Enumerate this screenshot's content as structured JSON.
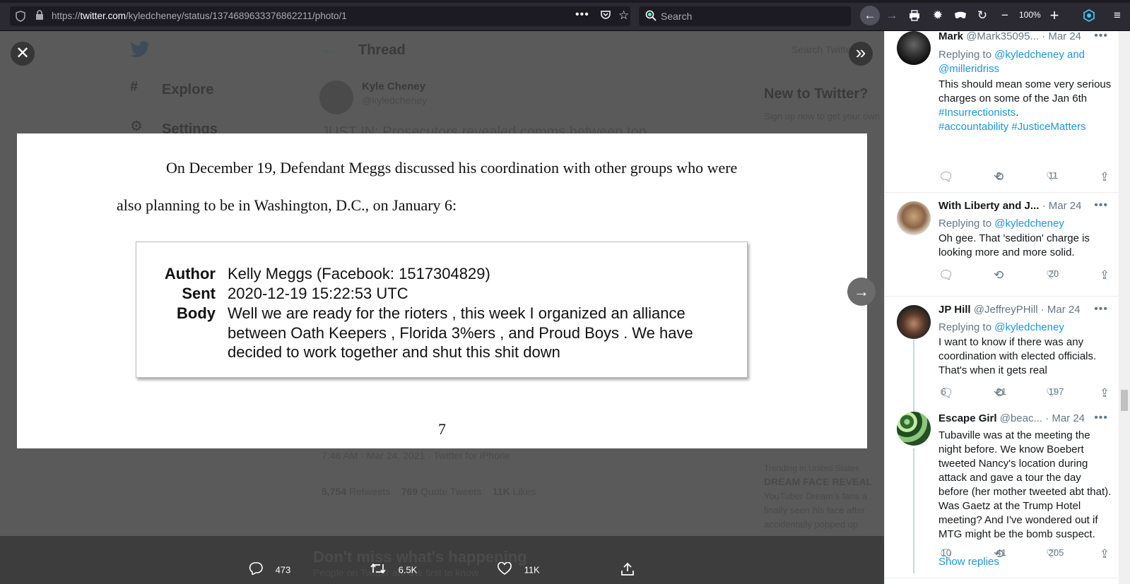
{
  "browser": {
    "url_prefix": "https://",
    "url_domain": "twitter.com",
    "url_path": "/kyledcheney/status/1374689633376862211/photo/1",
    "search_placeholder": "Search",
    "zoom": "100%"
  },
  "background": {
    "nav_explore": "Explore",
    "nav_settings": "Settings",
    "header_title": "Thread",
    "search_placeholder": "Search Twitter",
    "author_name": "Kyle Cheney",
    "author_handle": "@kyledcheney",
    "new_to_twitter": "New to Twitter?",
    "signup_text": "Sign up now to get your own",
    "tweet_preview": "JUST IN: Prosecutors revealed comms between top",
    "timestamp": "7:48 AM · Mar 24, 2021 · Twitter for iPhone",
    "retweets_count": "5,754",
    "retweets_label": "Retweets",
    "quotes_count": "769",
    "quotes_label": "Quote Tweets",
    "likes_count": "11K",
    "likes_label": "Likes",
    "trending_label": "Trending in United States",
    "trending_title": "DREAM FACE REVEAL",
    "trending_desc_1": "YouTuber Dream's fans a",
    "trending_desc_2": "finally seen his face after",
    "trending_desc_3": "accidentally popped up",
    "banner_title": "Don't miss what's happening",
    "banner_sub": "People on Twitter are the first to know."
  },
  "photo": {
    "para_line1": "On December 19, Defendant Meggs discussed his coordination with other groups who were",
    "para_line2": "also planning to be in Washington, D.C., on January 6:",
    "author_label": "Author",
    "author_value": "Kelly Meggs (Facebook: 1517304829)",
    "sent_label": "Sent",
    "sent_value": "2020-12-19 15:22:53 UTC",
    "body_label": "Body",
    "body_line1": "Well we are ready for the rioters , this week I organized an alliance",
    "body_line2": "between Oath Keepers , Florida 3%ers , and Proud Boys . We have",
    "body_line3": "decided to work together and shut this shit down",
    "page_number": "7"
  },
  "photo_actions": {
    "replies": "473",
    "retweets": "6.5K",
    "likes": "11K"
  },
  "replies": [
    {
      "name": "Mark",
      "handle": "@Mark35095...",
      "date": "· Mar 24",
      "replying_prefix": "Replying to ",
      "replying_to_1": "@kyledcheney and",
      "replying_to_2": "@milleridriss",
      "text": "This should mean some very serious charges on some of the Jan 6th",
      "hashtag_1": "#Insurrectionists",
      "hashtag_1_suffix": ".",
      "hashtag_2": "#accountability",
      "hashtag_3": "#JusticeMatters",
      "replies": "",
      "retweets": "2",
      "likes": "11"
    },
    {
      "name": "With Liberty and J...",
      "handle": "",
      "date": "· Mar 24",
      "replying_prefix": "Replying to ",
      "replying_to_1": "@kyledcheney",
      "text": "Oh gee. That 'sedition' charge is looking more and more solid.",
      "replies": "",
      "retweets": "",
      "likes": "20"
    },
    {
      "name": "JP Hill",
      "handle": "@JeffreyPHill",
      "date": "· Mar 24",
      "replying_prefix": "Replying to ",
      "replying_to_1": "@kyledcheney",
      "text": "I want to know if there was any coordination with elected officials. That's when it gets real",
      "replies": "6",
      "retweets": "21",
      "likes": "197"
    },
    {
      "name": "Escape Girl",
      "handle": "@beac...",
      "date": "· Mar 24",
      "text": "Tubaville was at the meeting the night before. We know Boebert tweeted Nancy's location during attack and gave a tour the day before (her mother tweeted abt that). Was Gaetz at the Trump Hotel meeting? And I've wondered out if MTG might be the bomb suspect.",
      "replies": "10",
      "retweets": "41",
      "likes": "205"
    }
  ],
  "show_replies": "Show replies",
  "icons": {
    "close": "close-icon",
    "collapse": "double-chevron-right-icon",
    "next": "arrow-right-icon",
    "reply": "reply-icon",
    "retweet": "retweet-icon",
    "like": "heart-icon",
    "share": "share-icon"
  },
  "colors": {
    "link": "#1b95e0",
    "secondary_text": "#657786",
    "primary_text": "#14171a"
  }
}
